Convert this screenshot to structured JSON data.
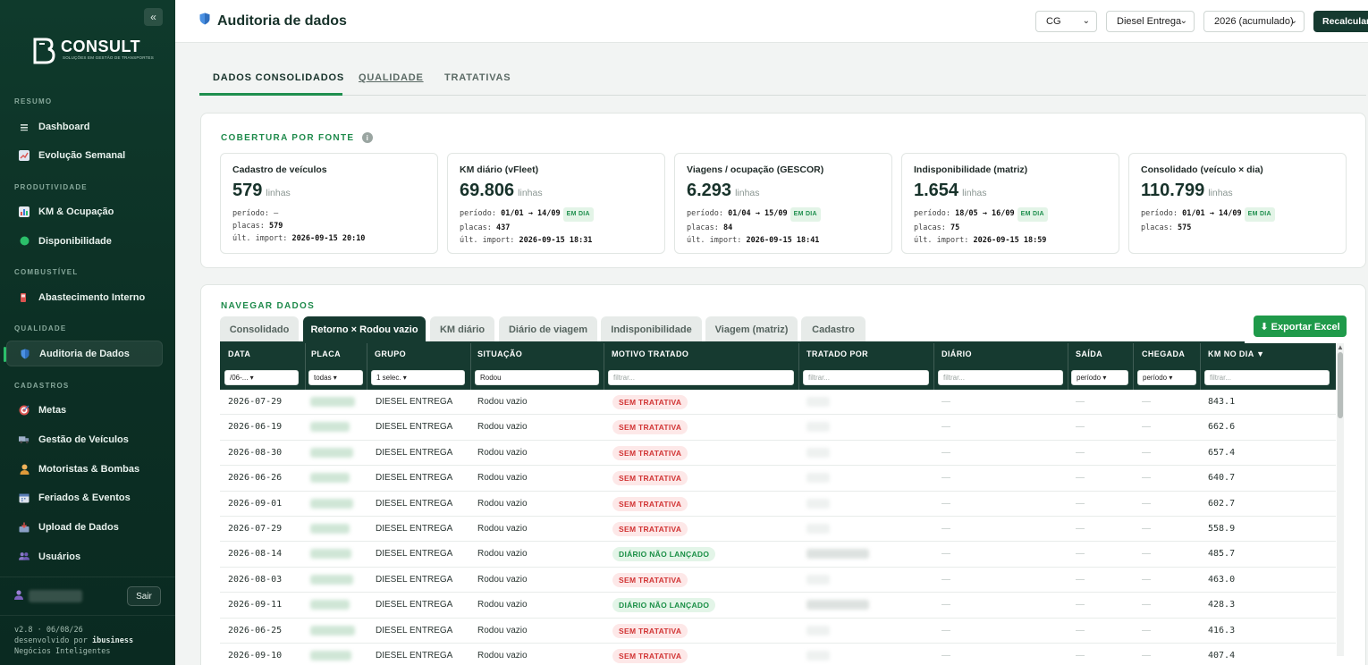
{
  "sidebar": {
    "collapse_label": "«",
    "logo": {
      "word": "CONSULT",
      "tagline": "SOLUÇÕES EM GESTÃO DE TRANSPORTES"
    },
    "sections": {
      "resumo": "RESUMO",
      "produtividade": "PRODUTIVIDADE",
      "combustivel": "COMBUSTÍVEL",
      "qualidade": "QUALIDADE",
      "cadastros": "CADASTROS"
    },
    "items": {
      "dashboard": "Dashboard",
      "evolucao": "Evolução Semanal",
      "km_ocupacao": "KM & Ocupação",
      "disponibilidade": "Disponibilidade",
      "abastecimento": "Abastecimento Interno",
      "auditoria": "Auditoria de Dados",
      "metas": "Metas",
      "veiculos": "Gestão de Veículos",
      "motoristas": "Motoristas & Bombas",
      "feriados": "Feriados & Eventos",
      "upload": "Upload de Dados",
      "usuarios": "Usuários"
    },
    "logout_label": "Sair",
    "version_line1": "v2.8 · 06/08/26",
    "version_line2_prefix": "desenvolvido por",
    "version_line2_brand": "ibusiness",
    "version_line3": "Negócios Inteligentes"
  },
  "header": {
    "title": "Auditoria de dados",
    "filters": {
      "unit": "CG",
      "group": "Diesel Entrega",
      "period": "2026 (acumulado)"
    },
    "recalc_label": "Recalcular"
  },
  "main_tabs": [
    "DADOS CONSOLIDADOS",
    "QUALIDADE",
    "TRATATIVAS"
  ],
  "coverage": {
    "title": "COBERTURA POR FONTE",
    "status_badge": "EM DIA",
    "unit": "linhas",
    "labels": {
      "periodo": "período:",
      "placas": "placas:",
      "ult_import": "últ. import:"
    },
    "sources": [
      {
        "name": "Cadastro de veículos",
        "count": "579",
        "periodo": "—",
        "placas": "579",
        "ult_import": "2026-09-15 20:10"
      },
      {
        "name": "KM diário (vFleet)",
        "count": "69.806",
        "periodo": "01/01 → 14/09",
        "placas": "437",
        "ult_import": "2026-09-15 18:31"
      },
      {
        "name": "Viagens / ocupação (GESCOR)",
        "count": "6.293",
        "periodo": "01/04 → 15/09",
        "placas": "84",
        "ult_import": "2026-09-15 18:41"
      },
      {
        "name": "Indisponibilidade (matriz)",
        "count": "1.654",
        "periodo": "18/05 → 16/09",
        "placas": "75",
        "ult_import": "2026-09-15 18:59"
      },
      {
        "name": "Consolidado (veículo × dia)",
        "count": "110.799",
        "periodo": "01/01 → 14/09",
        "placas": "575",
        "ult_import": ""
      }
    ]
  },
  "navigate": {
    "title": "NAVEGAR DADOS",
    "tabs": [
      "Consolidado",
      "Retorno × Rodou vazio",
      "KM diário",
      "Diário de viagem",
      "Indisponibilidade",
      "Viagem (matriz)",
      "Cadastro"
    ],
    "export_label": "⬇ Exportar Excel",
    "columns": [
      "DATA",
      "PLACA",
      "GRUPO",
      "SITUAÇÃO",
      "MOTIVO TRATADO",
      "TRATADO POR",
      "DIÁRIO",
      "SAÍDA",
      "CHEGADA",
      "KM NO DIA ▼"
    ],
    "filters": {
      "data": "/06-... ▾",
      "placa": "todas ▾",
      "grupo": "1 selec. ▾",
      "situacao": "Rodou",
      "motivo": "filtrar...",
      "tratado": "filtrar...",
      "diario": "filtrar...",
      "saida": "período ▾",
      "chegada": "período ▾",
      "km": "filtrar..."
    },
    "rows": [
      {
        "data": "2026-07-29",
        "grupo": "DIESEL ENTREGA",
        "situacao": "Rodou vazio",
        "motivo": "SEM TRATATIVA",
        "diario": "—",
        "saida": "—",
        "chegada": "—",
        "km": "843.1"
      },
      {
        "data": "2026-06-19",
        "grupo": "DIESEL ENTREGA",
        "situacao": "Rodou vazio",
        "motivo": "SEM TRATATIVA",
        "diario": "—",
        "saida": "—",
        "chegada": "—",
        "km": "662.6"
      },
      {
        "data": "2026-08-30",
        "grupo": "DIESEL ENTREGA",
        "situacao": "Rodou vazio",
        "motivo": "SEM TRATATIVA",
        "diario": "—",
        "saida": "—",
        "chegada": "—",
        "km": "657.4"
      },
      {
        "data": "2026-06-26",
        "grupo": "DIESEL ENTREGA",
        "situacao": "Rodou vazio",
        "motivo": "SEM TRATATIVA",
        "diario": "—",
        "saida": "—",
        "chegada": "—",
        "km": "640.7"
      },
      {
        "data": "2026-09-01",
        "grupo": "DIESEL ENTREGA",
        "situacao": "Rodou vazio",
        "motivo": "SEM TRATATIVA",
        "diario": "—",
        "saida": "—",
        "chegada": "—",
        "km": "602.7"
      },
      {
        "data": "2026-07-29",
        "grupo": "DIESEL ENTREGA",
        "situacao": "Rodou vazio",
        "motivo": "SEM TRATATIVA",
        "diario": "—",
        "saida": "—",
        "chegada": "—",
        "km": "558.9"
      },
      {
        "data": "2026-08-14",
        "grupo": "DIESEL ENTREGA",
        "situacao": "Rodou vazio",
        "motivo": "DIÁRIO NÃO LANÇADO",
        "diario": "—",
        "saida": "—",
        "chegada": "—",
        "km": "485.7"
      },
      {
        "data": "2026-08-03",
        "grupo": "DIESEL ENTREGA",
        "situacao": "Rodou vazio",
        "motivo": "SEM TRATATIVA",
        "diario": "—",
        "saida": "—",
        "chegada": "—",
        "km": "463.0"
      },
      {
        "data": "2026-09-11",
        "grupo": "DIESEL ENTREGA",
        "situacao": "Rodou vazio",
        "motivo": "DIÁRIO NÃO LANÇADO",
        "diario": "—",
        "saida": "—",
        "chegada": "—",
        "km": "428.3"
      },
      {
        "data": "2026-06-25",
        "grupo": "DIESEL ENTREGA",
        "situacao": "Rodou vazio",
        "motivo": "SEM TRATATIVA",
        "diario": "—",
        "saida": "—",
        "chegada": "—",
        "km": "416.3"
      },
      {
        "data": "2026-09-10",
        "grupo": "DIESEL ENTREGA",
        "situacao": "Rodou vazio",
        "motivo": "SEM TRATATIVA",
        "diario": "—",
        "saida": "—",
        "chegada": "—",
        "km": "407.4"
      }
    ]
  },
  "colors": {
    "accent": "#1f8f4e",
    "sidebar_bg": "#0f3a2c",
    "table_header": "#163a30",
    "danger": "#d13434"
  }
}
